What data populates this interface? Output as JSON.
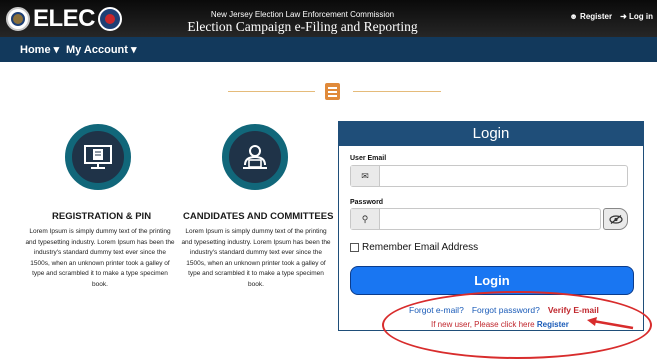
{
  "header": {
    "logo_text": "ELEC",
    "subtitle": "New Jersey Election Law Enforcement Commission",
    "title": "Election Campaign e-Filing and Reporting System",
    "register_label": "Register",
    "login_label": "Log in"
  },
  "nav": {
    "home_label": "Home ▾",
    "account_label": "My Account ▾"
  },
  "features": [
    {
      "title": "REGISTRATION & PIN",
      "text": "Lorem Ipsum is simply dummy text of the printing and typesetting industry. Lorem Ipsum has been the industry's standard dummy text ever since the 1500s, when an unknown printer took a galley of type and scrambled it to make a type specimen book.",
      "icon": "monitor-document-icon"
    },
    {
      "title": "CANDIDATES AND COMMITTEES",
      "text": "Lorem Ipsum is simply dummy text of the printing and typesetting industry. Lorem Ipsum has been the industry's standard dummy text ever since the 1500s, when an unknown printer took a galley of type and scrambled it to make a type specimen book.",
      "icon": "person-laptop-icon"
    }
  ],
  "login": {
    "heading": "Login",
    "email_label": "User Email",
    "email_value": "",
    "password_label": "Password",
    "password_value": "",
    "remember_label": "Remember Email Address",
    "button_label": "Login",
    "forgot_email": "Forgot e-mail?",
    "forgot_password": "Forgot password?",
    "verify_email": "Verify E-mail",
    "new_user_text": "If new user, Please click here",
    "register_link": "Register"
  },
  "colors": {
    "topbar": "#1a1a1a",
    "navbar": "#12395c",
    "login_header": "#1f4e79",
    "login_button": "#1976f2",
    "accent_red": "#c0262c",
    "circle_border": "#11677a"
  }
}
